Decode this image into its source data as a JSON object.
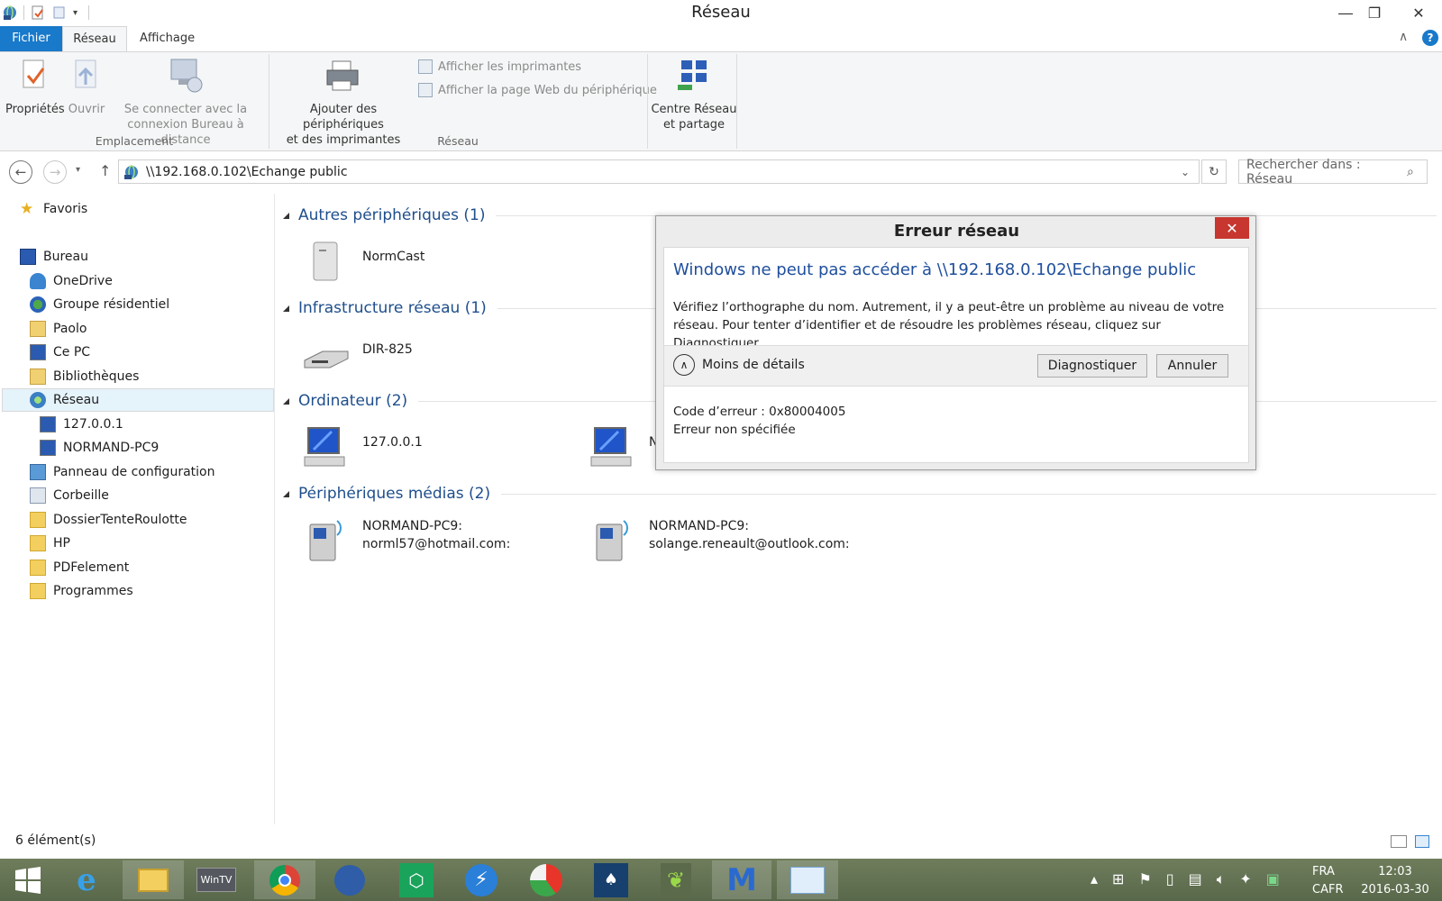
{
  "window": {
    "title": "Réseau"
  },
  "ribbon": {
    "tabs": {
      "file": "Fichier",
      "network": "Réseau",
      "view": "Affichage"
    },
    "properties": "Propriétés",
    "open": "Ouvrir",
    "connect_rd_1": "Se connecter avec la",
    "connect_rd_2": "connexion Bureau à distance",
    "group_location": "Emplacement",
    "add_devices_1": "Ajouter des périphériques",
    "add_devices_2": "et des imprimantes",
    "show_printers": "Afficher les imprimantes",
    "show_device_web": "Afficher la page Web du périphérique",
    "group_network": "Réseau",
    "center_1": "Centre Réseau",
    "center_2": "et partage"
  },
  "address": {
    "path": "\\\\192.168.0.102\\Echange public"
  },
  "search": {
    "placeholder": "Rechercher dans : Réseau"
  },
  "tree": {
    "favorites": "Favoris",
    "desktop": "Bureau",
    "onedrive": "OneDrive",
    "homegroup": "Groupe résidentiel",
    "paolo": "Paolo",
    "thispc": "Ce PC",
    "libraries": "Bibliothèques",
    "network": "Réseau",
    "host1": "127.0.0.1",
    "host2": "NORMAND-PC9",
    "control_panel": "Panneau de configuration",
    "recycle": "Corbeille",
    "folder1": "DossierTenteRoulotte",
    "folder2": "HP",
    "folder3": "PDFelement",
    "folder4": "Programmes"
  },
  "groups": {
    "other": "Autres périphériques (1)",
    "infra": "Infrastructure réseau (1)",
    "computers": "Ordinateur (2)",
    "media": "Périphériques médias (2)"
  },
  "items": {
    "normcast": "NormCast",
    "router": "DIR-825",
    "pc1": "127.0.0.1",
    "pc2_partial": "N",
    "media1_1": "NORMAND-PC9:",
    "media1_2": "norml57@hotmail.com:",
    "media2_1": "NORMAND-PC9:",
    "media2_2": "solange.reneault@outlook.com:"
  },
  "dialog": {
    "title": "Erreur réseau",
    "heading": "Windows ne peut pas accéder à \\\\192.168.0.102\\Echange public",
    "message": "Vérifiez l’orthographe du nom. Autrement, il y a peut-être un problème au niveau de votre réseau. Pour tenter d’identifier et de résoudre les problèmes réseau, cliquez sur Diagnostiquer.",
    "less_details": "Moins de détails",
    "diagnose": "Diagnostiquer",
    "cancel": "Annuler",
    "error_code": "Code d’erreur : 0x80004005",
    "error_desc": "Erreur non spécifiée"
  },
  "status": {
    "count": "6 élément(s)"
  },
  "taskbar": {
    "lang1": "FRA",
    "lang2": "CAFR",
    "time": "12:03",
    "date": "2016-03-30",
    "wintv": "WinTV"
  },
  "colors": {
    "accent": "#1979ca",
    "link": "#1e4e8c",
    "close": "#c7362f"
  }
}
